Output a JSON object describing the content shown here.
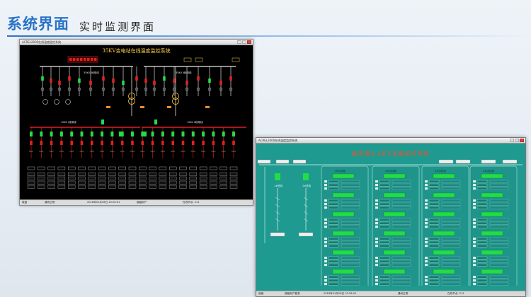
{
  "header": {
    "title": "系统界面",
    "subtitle": "实时监测界面"
  },
  "screen1": {
    "window_title": "ACREL2000在线温度监控系统",
    "title": "35KV变电站在线温度监控系统",
    "labels": {
      "bus_upper_left": "35KV Ⅰ段母线",
      "bus_upper_right": "35KV Ⅱ段母线",
      "bus_lower_left": "10KV Ⅰ段母线",
      "bus_lower_right": "10KV Ⅱ段母线"
    },
    "status_bar": [
      "就绪",
      "通讯正常",
      "2018年01月26日 10:26:01",
      "超级用户",
      "在线节点: 211"
    ]
  },
  "screen2": {
    "window_title": "ACREL2000在线温度监控系统",
    "title": "高压侧0.4KV温度监控系统",
    "left_labels": [
      "1#进线",
      "2#进线"
    ],
    "panel_titles": [
      "1#出线柜",
      "2#出线柜",
      "3#出线柜",
      "4#出线柜"
    ],
    "status_bar": [
      "就绪",
      "超级用户登录",
      "2018年01月26日 10:26:01",
      "通讯正常",
      "在线节点: 211"
    ]
  },
  "colors": {
    "accent": "#2a73c8",
    "screen1_bg": "#000000",
    "screen2_bg": "#1e9a90",
    "alarm_red": "#e02020",
    "node_green": "#22dd44",
    "title_yellow": "#ffd34d"
  }
}
